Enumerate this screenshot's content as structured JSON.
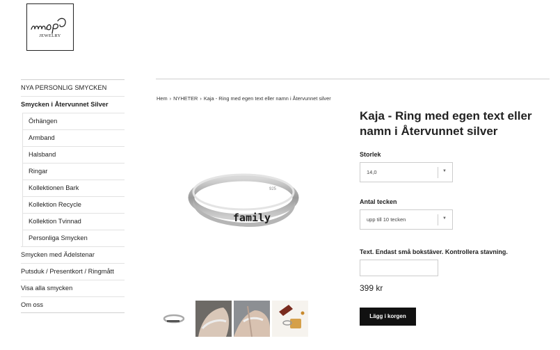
{
  "logo": {
    "text": "mnop",
    "sub": "JEWELRY"
  },
  "sidebar": {
    "items": [
      {
        "label": "NYA PERSONLIG SMYCKEN"
      },
      {
        "label": "Smycken i Återvunnet Silver"
      },
      {
        "label": "Smycken med Ädelstenar"
      },
      {
        "label": "Putsduk / Presentkort / Ringmått"
      },
      {
        "label": "Visa alla smycken"
      },
      {
        "label": "Om oss"
      }
    ],
    "subitems": [
      {
        "label": "Örhängen"
      },
      {
        "label": "Armband"
      },
      {
        "label": "Halsband"
      },
      {
        "label": "Ringar"
      },
      {
        "label": "Kollektionen Bark"
      },
      {
        "label": "Kollektion Recycle"
      },
      {
        "label": "Kollektion Tvinnad"
      },
      {
        "label": "Personliga Smycken"
      }
    ]
  },
  "breadcrumb": {
    "home": "Hem",
    "sep": "›",
    "category": "NYHETER",
    "current": "Kaja - Ring med egen text eller namn i Återvunnet silver"
  },
  "product": {
    "title": "Kaja - Ring med egen text eller namn i Återvunnet silver",
    "engraving": "family",
    "stamp": "925",
    "size_label": "Storlek",
    "size_value": "14,0",
    "chars_label": "Antal tecken",
    "chars_value": "upp till 10 tecken",
    "text_label": "Text. Endast små bokstäver. Kontrollera stavning.",
    "text_value": "",
    "price": "399 kr",
    "buy_label": "Lägg i korgen",
    "arrow_glyph": "▼"
  },
  "colors": {
    "accent": "#111111",
    "border": "#cccccc",
    "silver": "#a9a9a9"
  }
}
